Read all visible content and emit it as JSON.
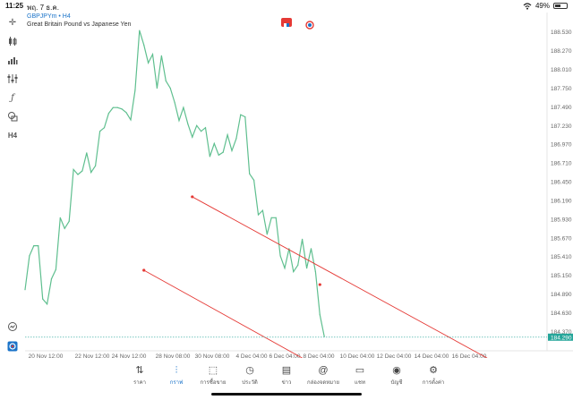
{
  "status_bar": {
    "time": "11:25",
    "date": "พฤ. 7 ธ.ค.",
    "battery": "49%"
  },
  "chart_header": {
    "symbol": "GBPJPYm • H4",
    "description": "Great Britain Pound vs Japanese Yen"
  },
  "toolbar": {
    "timeframe": "H4"
  },
  "nav": [
    {
      "label": "ราคา",
      "icon": "arrows-updown-icon"
    },
    {
      "label": "กราฟ",
      "icon": "candles-icon"
    },
    {
      "label": "การซื้อขาย",
      "icon": "trade-chart-icon"
    },
    {
      "label": "ประวัติ",
      "icon": "history-icon"
    },
    {
      "label": "ข่าว",
      "icon": "news-icon"
    },
    {
      "label": "กล่องจดหมาย",
      "icon": "mailbox-icon"
    },
    {
      "label": "แชท",
      "icon": "chat-icon"
    },
    {
      "label": "บัญชี",
      "icon": "account-icon"
    },
    {
      "label": "การตั้งค่า",
      "icon": "settings-icon"
    }
  ],
  "nav_active_index": 1,
  "colors": {
    "line": "#5fbf8f",
    "trendline": "#e53935",
    "accent": "#1a73c9",
    "current_price_bg": "#26a69a"
  },
  "chart_data": {
    "type": "line",
    "series": [
      {
        "values": [
          184.95,
          185.42,
          185.56,
          185.56,
          184.82,
          184.75,
          185.1,
          185.23,
          185.95,
          185.8,
          185.9,
          186.62,
          186.55,
          186.6,
          186.85,
          186.58,
          186.67,
          187.15,
          187.2,
          187.4,
          187.48,
          187.48,
          187.46,
          187.41,
          187.31,
          187.72,
          188.55,
          188.35,
          188.1,
          188.22,
          187.75,
          188.2,
          187.85,
          187.75,
          187.55,
          187.3,
          187.48,
          187.25,
          187.07,
          187.23,
          187.15,
          187.2,
          186.8,
          186.98,
          186.82,
          186.86,
          187.1,
          186.88,
          187.05,
          187.38,
          187.35,
          186.56,
          186.47,
          185.99,
          186.05,
          185.72,
          185.95,
          185.95,
          185.42,
          185.25,
          185.52,
          185.2,
          185.29,
          185.65,
          185.25,
          185.52,
          185.2,
          184.6,
          184.3
        ]
      }
    ],
    "ylim": [
      184.25,
      188.8
    ],
    "y_ticks": [
      "188.530",
      "188.270",
      "188.010",
      "187.750",
      "187.490",
      "187.230",
      "186.970",
      "186.710",
      "186.450",
      "186.190",
      "185.930",
      "185.670",
      "185.410",
      "185.150",
      "184.890",
      "184.630",
      "184.370"
    ],
    "x_ticks": [
      "20 Nov 12:00",
      "22 Nov 12:00",
      "24 Nov 12:00",
      "28 Nov 08:00",
      "30 Nov 08:00",
      "4 Dec 04:00",
      "6 Dec 04:00",
      "8 Dec 04:00",
      "10 Dec 04:00",
      "12 Dec 04:00",
      "14 Dec 04:00",
      "16 Dec 04:00"
    ],
    "current_price": "184.290",
    "current_price_value": 184.29,
    "trendlines": [
      {
        "from": [
          38,
          186.24
        ],
        "to": [
          105,
          184.0
        ]
      },
      {
        "from": [
          27,
          185.22
        ],
        "to": [
          63,
          184.0
        ]
      }
    ],
    "grid": false
  }
}
